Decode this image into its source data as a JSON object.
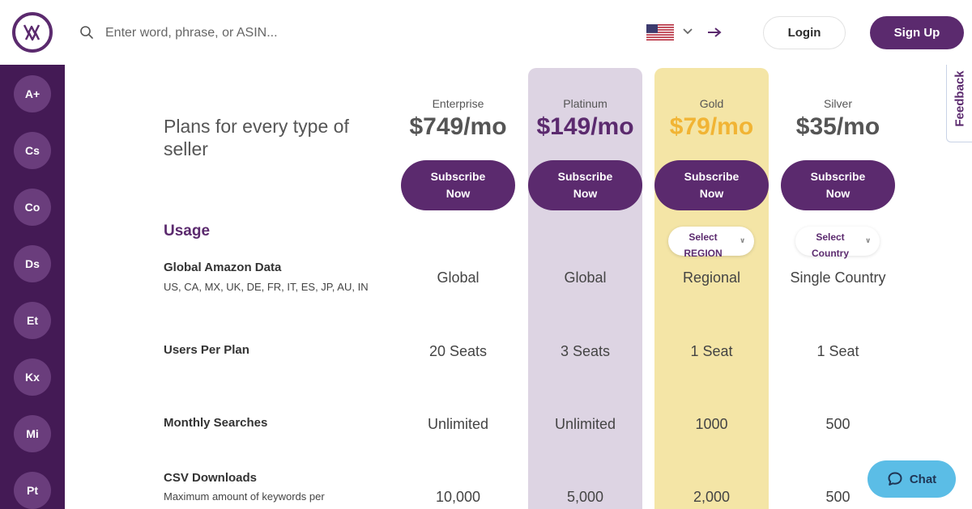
{
  "header": {
    "search_placeholder": "Enter word, phrase, or ASIN...",
    "login_label": "Login",
    "signup_label": "Sign Up",
    "flag_icon": "us-flag-icon"
  },
  "sidebar": {
    "items": [
      {
        "label": "A+"
      },
      {
        "label": "Cs"
      },
      {
        "label": "Co"
      },
      {
        "label": "Ds"
      },
      {
        "label": "Et"
      },
      {
        "label": "Kx"
      },
      {
        "label": "Mi"
      },
      {
        "label": "Pt"
      }
    ]
  },
  "pricing": {
    "title": "Plans for every type of seller",
    "usage_heading": "Usage",
    "plans": [
      {
        "name": "Enterprise",
        "price": "$749/mo",
        "subscribe": "Subscribe Now"
      },
      {
        "name": "Platinum",
        "price": "$149/mo",
        "subscribe": "Subscribe Now"
      },
      {
        "name": "Gold",
        "price": "$79/mo",
        "subscribe": "Subscribe Now"
      },
      {
        "name": "Silver",
        "price": "$35/mo",
        "subscribe": "Subscribe Now"
      }
    ],
    "gold_select": "Select REGION",
    "silver_select": "Select Country",
    "rows": [
      {
        "label": "Global Amazon Data",
        "sub": "US, CA, MX, UK, DE, FR, IT, ES, JP, AU, IN",
        "values": [
          "Global",
          "Global",
          "Regional",
          "Single Country"
        ]
      },
      {
        "label": "Users Per Plan",
        "sub": "",
        "values": [
          "20 Seats",
          "3 Seats",
          "1 Seat",
          "1 Seat"
        ]
      },
      {
        "label": "Monthly Searches",
        "sub": "",
        "values": [
          "Unlimited",
          "Unlimited",
          "1000",
          "500"
        ]
      },
      {
        "label": "CSV Downloads",
        "sub": "Maximum amount of keywords per",
        "values": [
          "10,000",
          "5,000",
          "2,000",
          "500"
        ]
      }
    ]
  },
  "feedback_label": "Feedback",
  "chat_label": "Chat",
  "colors": {
    "brand_purple": "#5b2a6e",
    "sidebar_bg": "#441a55",
    "platinum_bg": "#ddd4e3",
    "gold_bg": "#f4e5a6",
    "gold_price": "#f1b434",
    "chat_bg": "#5bbde6"
  }
}
